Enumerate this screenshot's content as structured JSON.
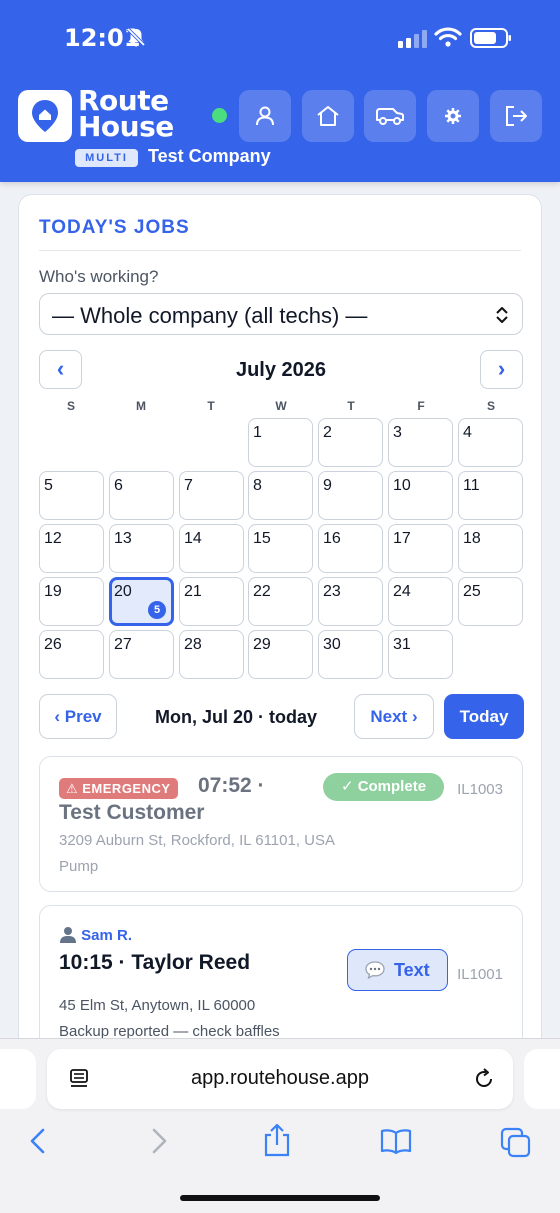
{
  "status": {
    "time": "12:01"
  },
  "header": {
    "brand_line1": "Route",
    "brand_line2": "House",
    "plan_badge": "MULTI",
    "company": "Test Company",
    "buttons": [
      "user-icon",
      "home-icon",
      "truck-icon",
      "gear-icon",
      "logout-icon"
    ]
  },
  "jobs_card": {
    "title": "TODAY'S JOBS",
    "who_label": "Who's working?",
    "who_value": "— Whole company (all techs) —"
  },
  "calendar": {
    "prev_label": "‹",
    "next_label": "›",
    "month_title": "July 2026",
    "weekdays": [
      "S",
      "M",
      "T",
      "W",
      "T",
      "F",
      "S"
    ],
    "days": [
      "1",
      "2",
      "3",
      "4",
      "5",
      "6",
      "7",
      "8",
      "9",
      "10",
      "11",
      "12",
      "13",
      "14",
      "15",
      "16",
      "17",
      "18",
      "19",
      "20",
      "21",
      "22",
      "23",
      "24",
      "25",
      "26",
      "27",
      "28",
      "29",
      "30",
      "31"
    ],
    "selected_day": "20",
    "selected_badge": "5"
  },
  "day_nav": {
    "prev_label": "‹ Prev",
    "current": "Mon, Jul 20 · today",
    "next_label": "Next ›",
    "today_label": "Today"
  },
  "jobs": [
    {
      "tag": "⚠ EMERGENCY",
      "time": "07:52 ·",
      "status": "✓ Complete",
      "id": "IL1003",
      "customer": "Test Customer",
      "address": "3209 Auburn St, Rockford, IL 61101, USA",
      "service": "Pump"
    },
    {
      "tech": "Sam R.",
      "title": "10:15 · Taylor Reed",
      "text_button": "Text",
      "id": "IL1001",
      "address": "45 Elm St, Anytown, IL 60000",
      "notes": "Backup reported — check baffles"
    }
  ],
  "browser": {
    "url": "app.routehouse.app"
  },
  "colors": {
    "brand": "#3563e9",
    "emergency": "#e07b7b",
    "complete": "#8fd19e"
  }
}
